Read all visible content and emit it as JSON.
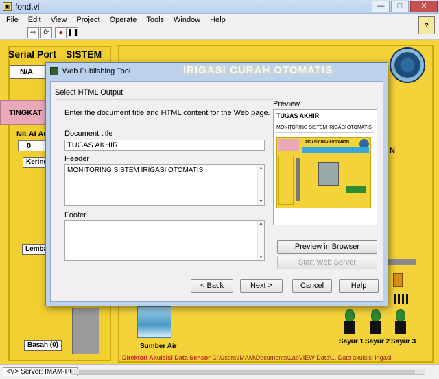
{
  "window": {
    "title": "fond.vi",
    "menu": [
      "File",
      "Edit",
      "View",
      "Project",
      "Operate",
      "Tools",
      "Window",
      "Help"
    ]
  },
  "front_panel": {
    "serial_port_label": "Serial Port",
    "sistem_label": "SISTEM",
    "serial_port_value": "N/A",
    "tingkat_label": "TINGKAT",
    "nilai_label": "NILAI ACU",
    "nilai_value": "0",
    "kering_label": "Kering",
    "lembab_label": "Lemba",
    "basah_label": "Basah (0)",
    "sumber_air_label": "Sumber Air",
    "right_side_label": "N",
    "sayur": [
      "Sayur 1",
      "Sayur 2",
      "Sayur 3"
    ],
    "direktori_label": "Direktori Akuisisi Data Sensor",
    "direktori_path": "C:\\Users\\IMAM\\Documents\\LabVIEW Data\\1. Data akuisisi Irigasi"
  },
  "statusbar": {
    "server": "<V> Server: IMAM-PC"
  },
  "dialog": {
    "title": "Web Publishing Tool",
    "behind_caption": "IRIGASI CURAH OTOMATIS",
    "section_heading": "Select HTML Output",
    "instruction": "Enter the document title and HTML content for the Web page.",
    "document_title_label": "Document title",
    "document_title_value": "TUGAS AKHIR",
    "header_label": "Header",
    "header_value": "MONITORING SISTEM IRIGASI OTOMATIS",
    "footer_label": "Footer",
    "footer_value": "",
    "preview_label": "Preview",
    "preview_title": "TUGAS AKHIR",
    "preview_header": "MONITORING SISTEM IRIGASI OTOMATIS",
    "preview_thumb_caption": "IRIGASI CURAH OTOMATIS",
    "buttons": {
      "preview_in_browser": "Preview in Browser",
      "start_web_server": "Start Web Server",
      "back": "< Back",
      "next": "Next >",
      "cancel": "Cancel",
      "help": "Help"
    }
  }
}
